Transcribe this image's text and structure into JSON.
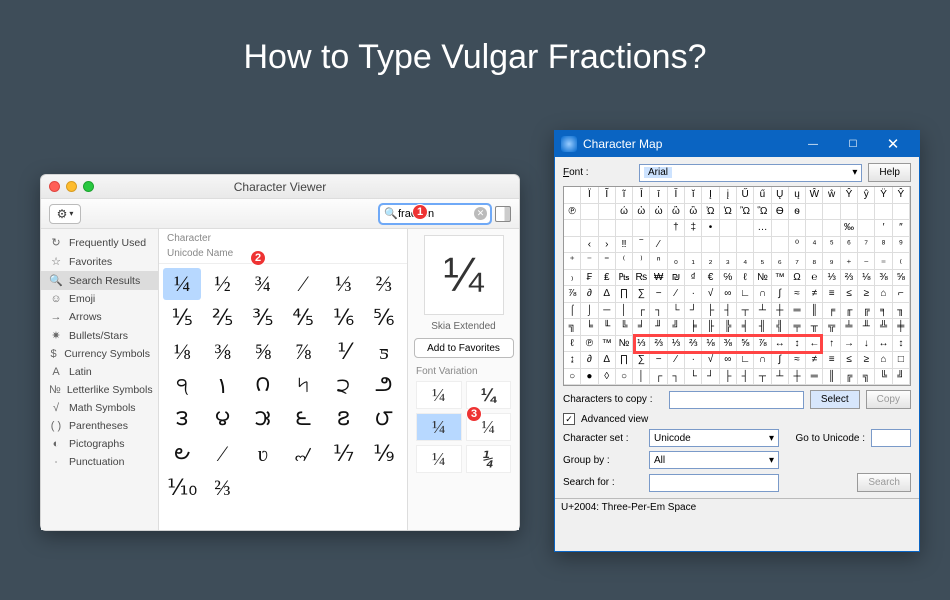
{
  "page": {
    "title": "How to Type Vulgar Fractions?"
  },
  "callouts": {
    "c1": "1",
    "c2": "2",
    "c3": "3"
  },
  "mac": {
    "window_title": "Character Viewer",
    "search_value": "fraction",
    "sidebar": {
      "items": [
        {
          "icon": "↻",
          "label": "Frequently Used"
        },
        {
          "icon": "☆",
          "label": "Favorites"
        },
        {
          "icon": "🔍",
          "label": "Search Results",
          "selected": true
        },
        {
          "icon": "☺",
          "label": "Emoji"
        },
        {
          "icon": "→",
          "label": "Arrows"
        },
        {
          "icon": "✷",
          "label": "Bullets/Stars"
        },
        {
          "icon": "$",
          "label": "Currency Symbols"
        },
        {
          "icon": "A",
          "label": "Latin"
        },
        {
          "icon": "№",
          "label": "Letterlike Symbols"
        },
        {
          "icon": "√",
          "label": "Math Symbols"
        },
        {
          "icon": "( )",
          "label": "Parentheses"
        },
        {
          "icon": "◐",
          "label": "Pictographs"
        },
        {
          "icon": "∙",
          "label": "Punctuation"
        }
      ]
    },
    "header_character": "Character",
    "header_unicode": "Unicode Name",
    "grid": [
      "¼",
      "½",
      "¾",
      "⁄",
      "⅓",
      "⅔",
      "⅕",
      "⅖",
      "⅗",
      "⅘",
      "⅙",
      "⅚",
      "⅛",
      "⅜",
      "⅝",
      "⅞",
      "⅟",
      "ƽ",
      "੧",
      "۱",
      "౧",
      "৸",
      "੨",
      "౨",
      "౩",
      "౪",
      "౫",
      "౬",
      "౭",
      "౮",
      "౿",
      "⁄",
      "ʋ",
      "୷",
      "⅐",
      "⅑",
      "⅒",
      "⅔",
      "",
      "",
      "",
      ""
    ],
    "selected_index": 0,
    "preview": {
      "glyph": "¼",
      "font": "Skia Extended",
      "fav_label": "Add to Favorites",
      "variation_header": "Font Variation",
      "variations": [
        "¼",
        "¼",
        "¼",
        "¼",
        "¼",
        "¼"
      ],
      "variation_selected": 2
    }
  },
  "win": {
    "window_title": "Character Map",
    "font_label": "Font :",
    "font_value": "Arial",
    "help_label": "Help",
    "copy_label_field": "Characters to copy :",
    "select_btn": "Select",
    "copy_btn": "Copy",
    "advanced_label": "Advanced view",
    "advanced_checked": true,
    "charset_label": "Character set :",
    "charset_value": "Unicode",
    "goto_label": "Go to Unicode :",
    "group_label": "Group by :",
    "group_value": "All",
    "search_label": "Search for :",
    "search_btn": "Search",
    "status": "U+2004: Three-Per-Em Space",
    "grid": [
      " ",
      "Ї",
      "Ĩ",
      "ĩ",
      "Ī",
      "ī",
      "Ĭ",
      "ĭ",
      "Į",
      "į",
      "Ű",
      "ű",
      "Ų",
      "ų",
      "Ŵ",
      "ŵ",
      "Ŷ",
      "ŷ",
      "Ÿ",
      "Ŷ",
      "℗",
      " ",
      " ",
      "ώ",
      "ὠ",
      "ὡ",
      "ὢ",
      "ὣ",
      "Ὠ",
      "Ὡ",
      "Ὢ",
      "Ὣ",
      "Ѳ",
      "ѳ",
      " ",
      " ",
      " ",
      " ",
      " ",
      " ",
      " ",
      " ",
      " ",
      " ",
      " ",
      " ",
      "†",
      "‡",
      "•",
      " ",
      " ",
      "…",
      " ",
      " ",
      " ",
      " ",
      "‰",
      " ",
      "′",
      "″",
      " ",
      "‹",
      "›",
      "‼",
      "‾",
      "⁄",
      " ",
      " ",
      " ",
      " ",
      " ",
      " ",
      " ",
      "⁰",
      "⁴",
      "⁵",
      "⁶",
      "⁷",
      "⁸",
      "⁹",
      "⁺",
      "⁻",
      "⁼",
      "⁽",
      "⁾",
      "ⁿ",
      "₀",
      "₁",
      "₂",
      "₃",
      "₄",
      "₅",
      "₆",
      "₇",
      "₈",
      "₉",
      "₊",
      "₋",
      "₌",
      "₍",
      "₎",
      "₣",
      "₤",
      "₧",
      "₨",
      "₩",
      "₪",
      "₫",
      "€",
      "℅",
      "ℓ",
      "№",
      "™",
      "Ω",
      "℮",
      "⅓",
      "⅔",
      "⅛",
      "⅜",
      "⅝",
      "⅞",
      "∂",
      "∆",
      "∏",
      "∑",
      "−",
      "∕",
      "∙",
      "√",
      "∞",
      "∟",
      "∩",
      "∫",
      "≈",
      "≠",
      "≡",
      "≤",
      "≥",
      "⌂",
      "⌐",
      "⌠",
      "⌡",
      "─",
      "│",
      "┌",
      "┐",
      "└",
      "┘",
      "├",
      "┤",
      "┬",
      "┴",
      "┼",
      "═",
      "║",
      "╒",
      "╓",
      "╔",
      "╕",
      "╖",
      "╗",
      "╘",
      "╙",
      "╚",
      "╛",
      "╜",
      "╝",
      "╞",
      "╟",
      "╠",
      "╡",
      "╢",
      "╣",
      "╤",
      "╥",
      "╦",
      "╧",
      "╨",
      "╩",
      "╪",
      "ℓ",
      "℗",
      "™",
      "№",
      "⅓",
      "⅔",
      "⅓",
      "⅔",
      "⅛",
      "⅜",
      "⅝",
      "⅞",
      "↔",
      "↕",
      "←",
      "↑",
      "→",
      "↓",
      "↔",
      "↕",
      "↨",
      "∂",
      "∆",
      "∏",
      "∑",
      "−",
      "∕",
      "∙",
      "√",
      "∞",
      "∟",
      "∩",
      "∫",
      "≈",
      "≠",
      "≡",
      "≤",
      "≥",
      "⌂",
      "□",
      "○",
      "●",
      "◊",
      "○",
      "│",
      "┌",
      "┐",
      "└",
      "┘",
      "├",
      "┤",
      "┬",
      "┴",
      "┼",
      "═",
      "║",
      "╔",
      "╗",
      "╚",
      "╝"
    ],
    "red_box": {
      "row": 9,
      "colStart": 4,
      "colEnd": 15
    }
  }
}
